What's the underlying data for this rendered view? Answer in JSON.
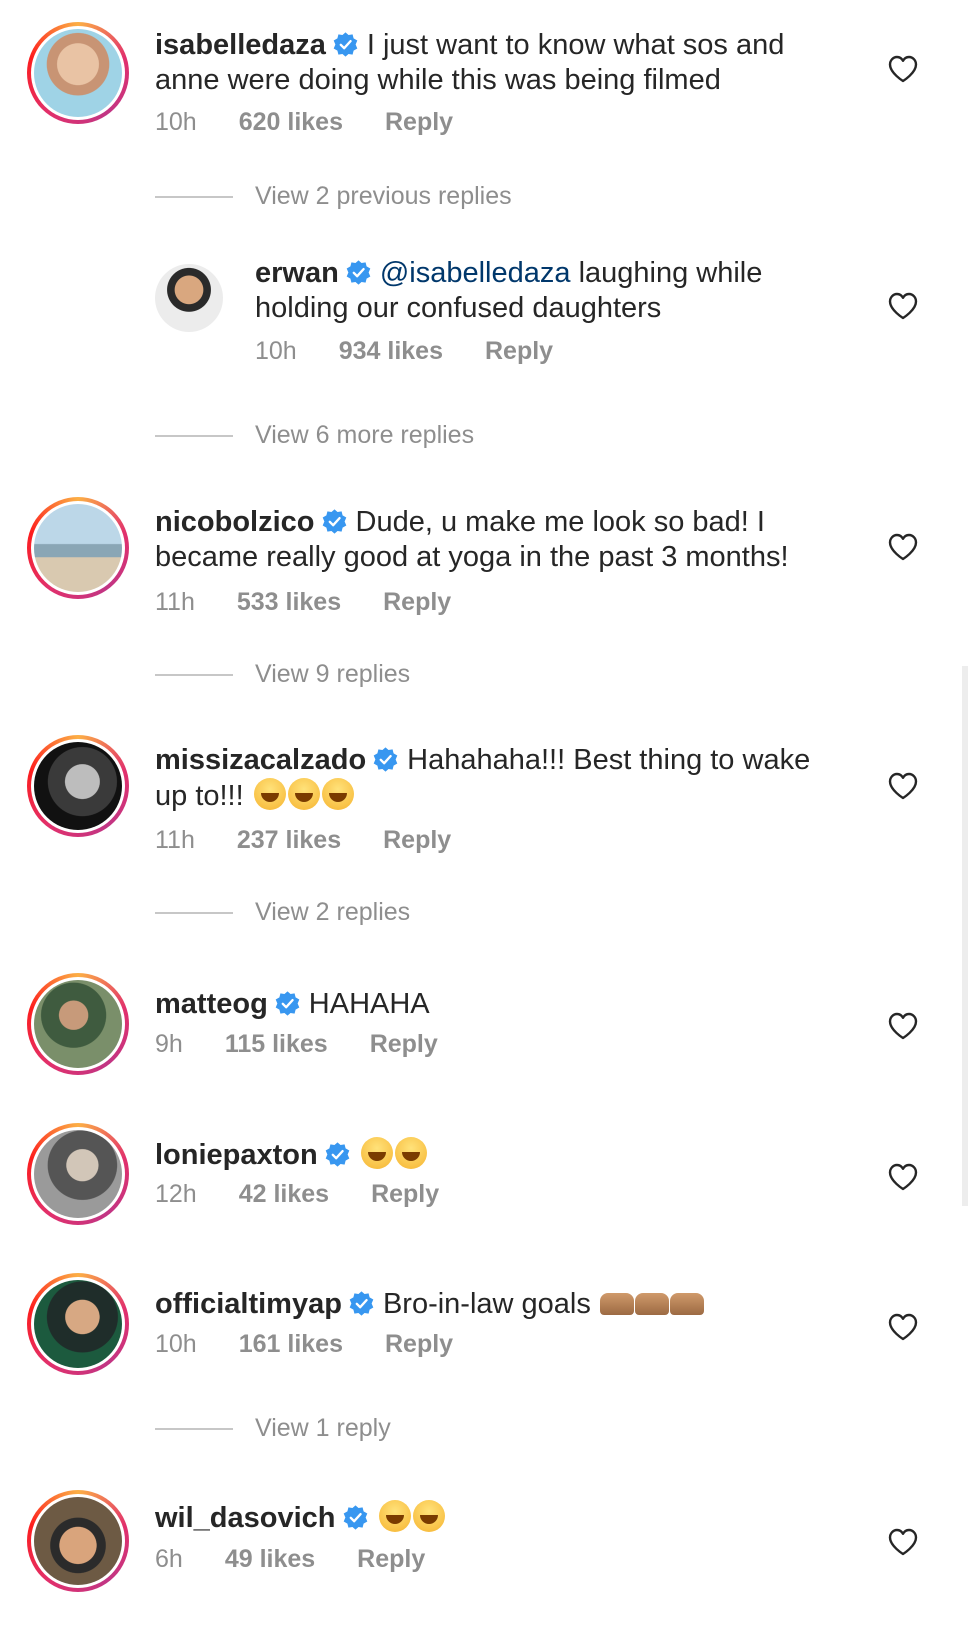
{
  "comments": [
    {
      "username": "isabelledaza",
      "text": "I just want to know what sos and anne were doing while this was being filmed",
      "time": "10h",
      "likes": "620 likes",
      "reply": "Reply"
    },
    {
      "username": "erwan",
      "mention": "@isabelledaza",
      "text": "laughing while holding our confused daughters",
      "time": "10h",
      "likes": "934 likes",
      "reply": "Reply"
    },
    {
      "username": "nicobolzico",
      "text": "Dude, u make me look so bad! I became really good at yoga in the past 3 months!",
      "time": "11h",
      "likes": "533 likes",
      "reply": "Reply"
    },
    {
      "username": "missizacalzado",
      "text": "Hahahaha!!! Best thing to wake up to!!!",
      "time": "11h",
      "likes": "237 likes",
      "reply": "Reply"
    },
    {
      "username": "matteog",
      "text": "HAHAHA",
      "time": "9h",
      "likes": "115 likes",
      "reply": "Reply"
    },
    {
      "username": "loniepaxton",
      "text": "",
      "time": "12h",
      "likes": "42 likes",
      "reply": "Reply"
    },
    {
      "username": "officialtimyap",
      "text": "Bro-in-law goals",
      "time": "10h",
      "likes": "161 likes",
      "reply": "Reply"
    },
    {
      "username": "wil_dasovich",
      "text": "",
      "time": "6h",
      "likes": "49 likes",
      "reply": "Reply"
    }
  ],
  "view_replies": [
    "View 2 previous replies",
    "View 6 more replies",
    "View 9 replies",
    "View 2 replies",
    "View 1 reply"
  ],
  "colors": {
    "verified": "#3897f0",
    "mention": "#00376b",
    "meta": "#8e8e8e"
  }
}
